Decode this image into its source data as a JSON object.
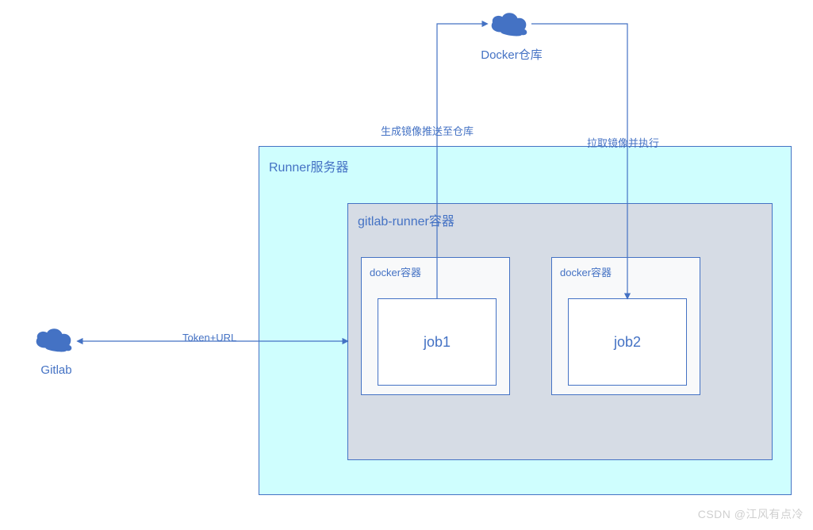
{
  "clouds": {
    "docker": {
      "label": "Docker仓库"
    },
    "gitlab": {
      "label": "Gitlab"
    }
  },
  "boxes": {
    "runner": {
      "label": "Runner服务器"
    },
    "gitlabRunner": {
      "label": "gitlab-runner容器"
    },
    "docker1": {
      "label": "docker容器"
    },
    "docker2": {
      "label": "docker容器"
    },
    "job1": {
      "label": "job1"
    },
    "job2": {
      "label": "job2"
    }
  },
  "edges": {
    "gitlabToRunner": {
      "label": "Token+URL"
    },
    "pushImage": {
      "label": "生成镜像推送至仓库"
    },
    "pullImage": {
      "label": "拉取镜像并执行"
    }
  },
  "watermark": "CSDN @江风有点冷",
  "colors": {
    "border": "#4472C4",
    "runnerFill": "#CFFEFE",
    "gitlabRunnerFill": "#D6DCE5",
    "dockerFill": "#F8F9FA",
    "text": "#4472C4"
  }
}
